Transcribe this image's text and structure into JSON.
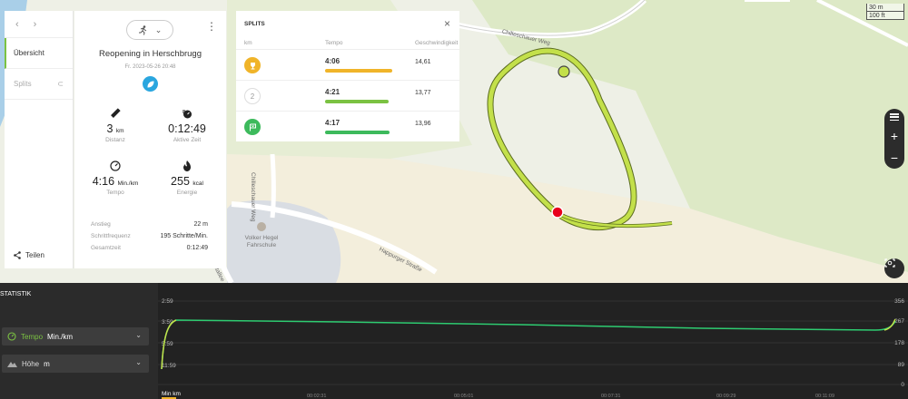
{
  "map": {
    "scale_m": "30 m",
    "scale_ft": "100 ft",
    "streets": [
      {
        "name": "Chilleschauer Weg"
      },
      {
        "name": "Chilleschauer Weg"
      },
      {
        "name": "Happurger Straße"
      },
      {
        "name": "Ostallee"
      }
    ],
    "poi_name": "Volker Hegel Fahrschule",
    "route_color": "#c3e04a",
    "start_color": "#c3e04a",
    "end_color": "#e8001c"
  },
  "sidebar": {
    "back": "‹",
    "forward": "›",
    "tabs": [
      {
        "label": "Übersicht"
      },
      {
        "label": "Splits"
      }
    ],
    "share_label": "Teilen"
  },
  "summary": {
    "activity_icon": "runner-icon",
    "title": "Reopening in Herschbrugg",
    "date": "Fr. 2023-05-26 20:48",
    "distance": {
      "value": "3",
      "unit": "km",
      "label": "Distanz"
    },
    "active_time": {
      "value": "0:12:49",
      "label": "Aktive Zeit"
    },
    "pace": {
      "value": "4:16",
      "unit": "Min./km",
      "label": "Tempo"
    },
    "energy": {
      "value": "255",
      "unit": "kcal",
      "label": "Energie"
    },
    "extras": [
      {
        "label": "Anstieg",
        "value": "22 m"
      },
      {
        "label": "Schrittfrequenz",
        "value": "195 Schritte/Min."
      },
      {
        "label": "Gesamtzeit",
        "value": "0:12:49"
      }
    ]
  },
  "splits": {
    "title": "SPLITS",
    "close": "×",
    "headers": {
      "km": "km",
      "tempo": "Tempo",
      "speed": "Geschwindigkeit"
    },
    "rows": [
      {
        "marker": "trophy-icon",
        "tempo": "4:06",
        "bar_fraction": 1.0,
        "bar_color": "#f0b429",
        "speed": "14,61"
      },
      {
        "marker": "2",
        "tempo": "4:21",
        "bar_fraction": 0.94,
        "bar_color": "#7bc242",
        "speed": "13,77"
      },
      {
        "marker": "flag-icon",
        "tempo": "4:17",
        "bar_fraction": 0.96,
        "bar_color": "#3dba5c",
        "speed": "13,96"
      }
    ]
  },
  "statistics": {
    "title": "STATISTIK",
    "metric1": {
      "name": "Tempo",
      "unit": "Min./km",
      "color": "#7bc242"
    },
    "metric2": {
      "name": "Höhe",
      "unit": "m"
    },
    "y_left_ticks": [
      "2:59",
      "3:59",
      "5:59",
      "11:59"
    ],
    "y_right_ticks": [
      "356",
      "267",
      "178",
      "89",
      "0"
    ],
    "x_ticks": [
      "00:02:31",
      "00:05:01",
      "00:07:31",
      "00:09:29",
      "00:11:09"
    ],
    "x_label": "Min km"
  }
}
